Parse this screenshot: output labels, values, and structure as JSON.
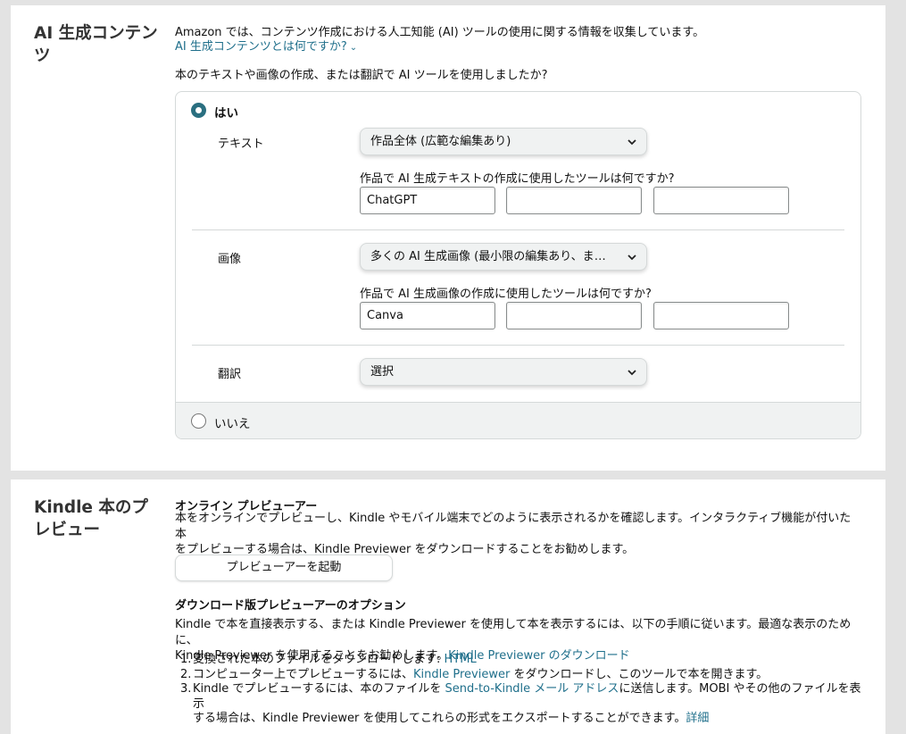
{
  "ai_section": {
    "title": "AI 生成コンテンツ",
    "intro": "Amazon では、コンテンツ作成における人工知能 (AI) ツールの使用に関する情報を収集しています。",
    "help_link": "AI 生成コンテンツとは何ですか?",
    "question": "本のテキストや画像の作成、または翻訳で AI ツールを使用しましたか?",
    "option_yes": "はい",
    "option_no": "いいえ",
    "selected": "はい",
    "text_row": {
      "label": "テキスト",
      "select_value": "作品全体 (広範な編集あり)",
      "tools_question": "作品で AI 生成テキストの作成に使用したツールは何ですか?",
      "tools": [
        "ChatGPT",
        "",
        ""
      ]
    },
    "image_row": {
      "label": "画像",
      "select_value": "多くの AI 生成画像 (最小限の編集あり、また…",
      "tools_question": "作品で AI 生成画像の作成に使用したツールは何ですか?",
      "tools": [
        "Canva",
        "",
        ""
      ]
    },
    "translation_row": {
      "label": "翻訳",
      "select_value": "選択"
    }
  },
  "kindle_section": {
    "title": "Kindle 本のプレビュー",
    "online_heading": "オンライン プレビューアー",
    "online_desc_1": "本をオンラインでプレビューし、Kindle やモバイル端末でどのように表示されるかを確認します。インタラクティブ機能が付いた本",
    "online_desc_2": "をプレビューする場合は、Kindle Previewer をダウンロードすることをお勧めします。",
    "launch_button": "プレビューアーを起動",
    "download_heading": "ダウンロード版プレビューアーのオプション",
    "download_desc_1": "Kindle で本を直接表示する、または Kindle Previewer を使用して本を表示するには、以下の手順に従います。最適な表示のために、",
    "download_desc_2": "Kindle Previewer を使用することをお勧めします。",
    "download_link": "Kindle Previewer のダウンロード",
    "step1_prefix": "変換された本のファイルをダウンロードします: ",
    "step1_link": "HTML",
    "step2_prefix": "コンピューター上でプレビューするには、",
    "step2_link": "Kindle Previewer",
    "step2_suffix": " をダウンロードし、このツールで本を開きます。",
    "step3_prefix": "Kindle でプレビューするには、本のファイルを ",
    "step3_link": "Send-to-Kindle メール アドレス",
    "step3_suffix_1": "に送信します。MOBI やその他のファイルを表示",
    "step3_suffix_2": "する場合は、Kindle Previewer を使用してこれらの形式をエクスポートすることができます。",
    "step3_more_link": "詳細",
    "step_numbers": [
      "1.",
      "2.",
      "3."
    ]
  },
  "colors": {
    "link": "#1f6f8b",
    "radio_selected": "#2a6f80",
    "page_background": "#e3e3e3"
  }
}
